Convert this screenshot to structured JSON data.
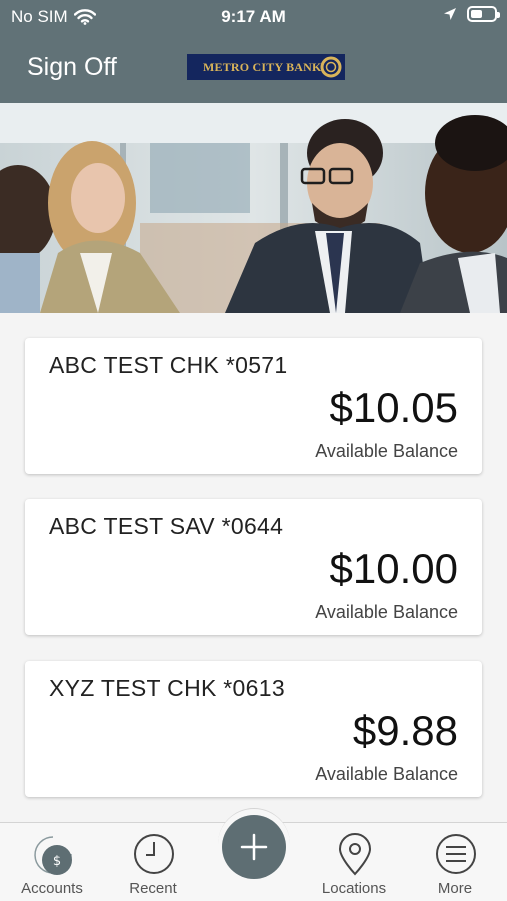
{
  "status_bar": {
    "carrier": "No SIM",
    "time": "9:17 AM",
    "battery_level": 0.5
  },
  "header": {
    "sign_off_label": "Sign Off",
    "logo_text": "METRO CITY BANK"
  },
  "accounts": [
    {
      "name": "ABC TEST CHK *0571",
      "balance": "$10.05",
      "balance_label": "Available Balance"
    },
    {
      "name": "ABC TEST SAV *0644",
      "balance": "$10.00",
      "balance_label": "Available Balance"
    },
    {
      "name": "XYZ TEST CHK *0613",
      "balance": "$9.88",
      "balance_label": "Available Balance"
    }
  ],
  "tab_bar": {
    "accounts": "Accounts",
    "recent": "Recent",
    "locations": "Locations",
    "more": "More"
  },
  "colors": {
    "header": "#617277",
    "tab_active": "#5e6e73",
    "brand_navy": "#14265e",
    "brand_gold": "#d9b45a"
  }
}
